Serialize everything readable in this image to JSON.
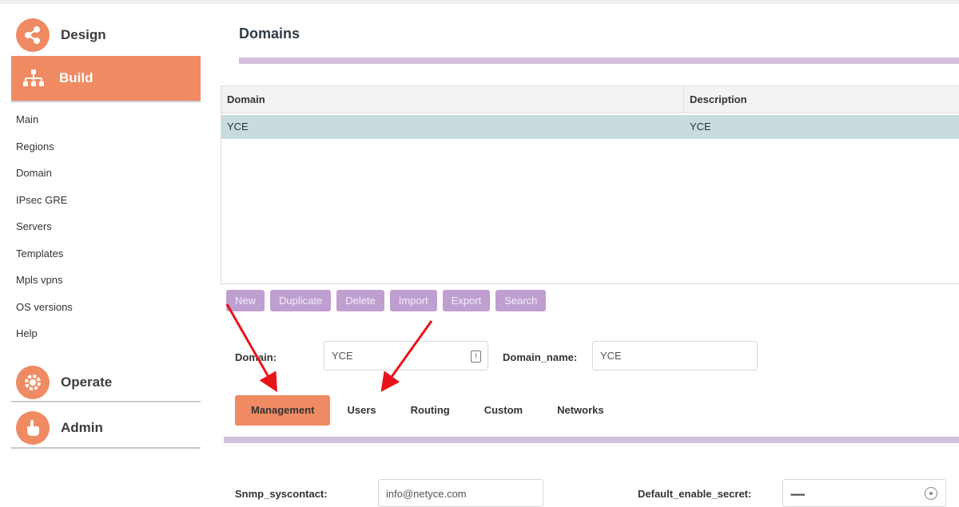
{
  "sidebar": {
    "sections": {
      "design": "Design",
      "build": "Build",
      "operate": "Operate",
      "admin": "Admin"
    },
    "build_items": [
      "Main",
      "Regions",
      "Domain",
      "IPsec GRE",
      "Servers",
      "Templates",
      "Mpls vpns",
      "OS versions",
      "Help"
    ]
  },
  "page": {
    "title": "Domains"
  },
  "grid": {
    "columns": [
      "Domain",
      "Description"
    ],
    "rows": [
      {
        "domain": "YCE",
        "description": "YCE"
      }
    ]
  },
  "toolbar": {
    "new": "New",
    "duplicate": "Duplicate",
    "delete": "Delete",
    "import": "Import",
    "export": "Export",
    "search": "Search"
  },
  "form": {
    "domain_label": "Domain:",
    "domain_value": "YCE",
    "domain_name_label": "Domain_name:",
    "domain_name_value": "YCE"
  },
  "tabs": {
    "management": "Management",
    "users": "Users",
    "routing": "Routing",
    "custom": "Custom",
    "networks": "Networks"
  },
  "management": {
    "snmp_label": "Snmp_syscontact:",
    "snmp_value": "info@netyce.com",
    "secret_label": "Default_enable_secret:",
    "secret_value": "•••••••"
  },
  "colors": {
    "accent_orange": "#ef8a62",
    "accent_purple": "#bf9fd0",
    "bar_lavender": "#d4bfdf",
    "selected_row": "#c8dce0",
    "annotation_arrow": "#e8141b"
  }
}
